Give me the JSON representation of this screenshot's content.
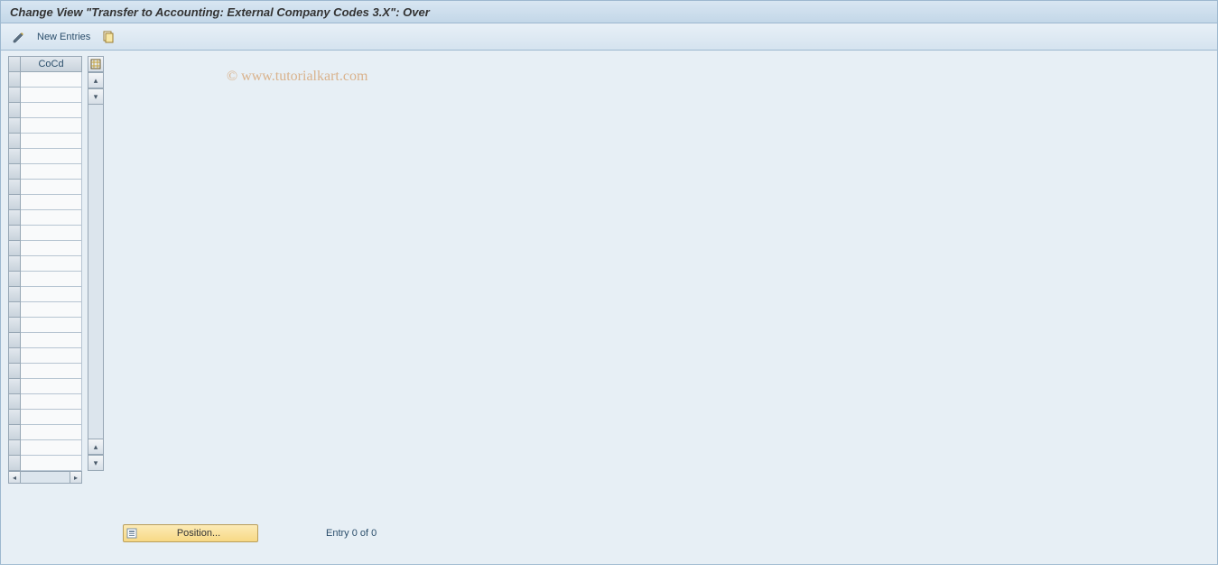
{
  "title": "Change View \"Transfer to Accounting: External Company Codes 3.X\": Over",
  "toolbar": {
    "new_entries_label": "New Entries"
  },
  "table": {
    "column_header": "CoCd",
    "row_count": 26
  },
  "footer": {
    "position_label": "Position...",
    "entry_text": "Entry 0 of 0"
  },
  "watermark": "© www.tutorialkart.com",
  "colors": {
    "header_bg_top": "#d8e6f2",
    "header_bg_bottom": "#c3d7e8",
    "content_bg": "#e7eff5",
    "accent_gold_top": "#fcebb6",
    "accent_gold_bottom": "#f7d985"
  }
}
